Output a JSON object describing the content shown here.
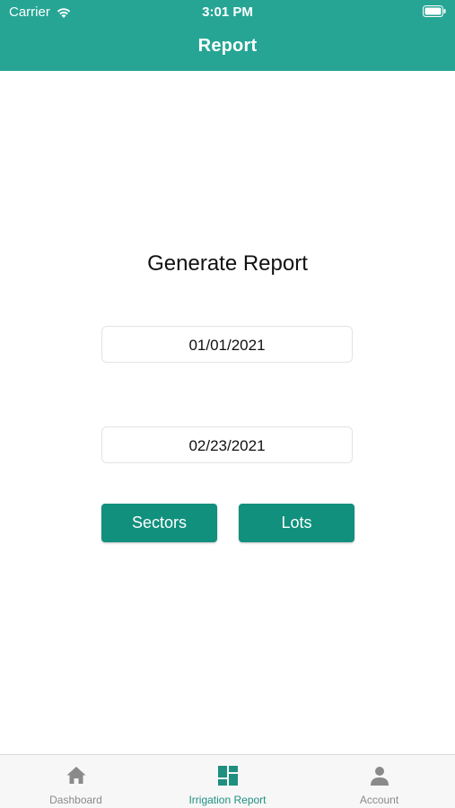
{
  "status_bar": {
    "carrier": "Carrier",
    "time": "3:01 PM",
    "icons": [
      "wifi-icon",
      "battery-icon"
    ]
  },
  "header": {
    "title": "Report"
  },
  "main": {
    "heading": "Generate Report",
    "start_date": "01/01/2021",
    "end_date": "02/23/2021",
    "sectors_label": "Sectors",
    "lots_label": "Lots"
  },
  "tabbar": {
    "items": [
      {
        "label": "Dashboard",
        "icon": "home-icon",
        "active": false
      },
      {
        "label": "Irrigation Report",
        "icon": "dashboard-grid-icon",
        "active": true
      },
      {
        "label": "Account",
        "icon": "person-icon",
        "active": false
      }
    ]
  },
  "colors": {
    "header": "#26a595",
    "button": "#11907d",
    "tab_active": "#1f8f80",
    "tab_inactive": "#8a8a8a"
  }
}
